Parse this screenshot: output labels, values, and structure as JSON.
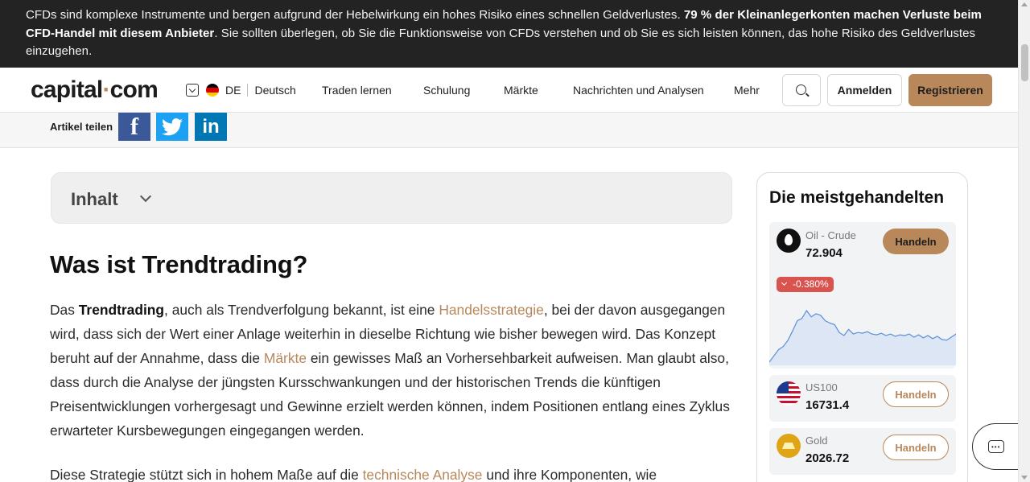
{
  "risk_banner": {
    "text_1": "CFDs sind komplexe Instrumente und bergen aufgrund der Hebelwirkung ein hohes Risiko eines schnellen Geldverlustes. ",
    "bold": "79 % der Kleinanlegerkonten machen Verluste beim CFD-Handel mit diesem Anbieter",
    "text_2": ". Sie sollten überlegen, ob Sie die Funktionsweise von CFDs verstehen und ob Sie es sich leisten können, das hohe Risiko des Geldverlustes einzugehen."
  },
  "header": {
    "logo_part1": "capital",
    "logo_dot": "·",
    "logo_part2": "com",
    "country_code": "DE",
    "language": "Deutsch",
    "nav": [
      "Traden lernen",
      "Schulung",
      "Märkte",
      "Nachrichten und Analysen",
      "Mehr"
    ],
    "login_label": "Anmelden",
    "register_label": "Registrieren"
  },
  "share": {
    "label": "Artikel teilen",
    "facebook": "f",
    "linkedin": "in"
  },
  "toc": {
    "title": "Inhalt"
  },
  "article": {
    "title": "Was ist Trendtrading?",
    "p1": {
      "t1": "Das ",
      "b1": "Trendtrading",
      "t2": ", auch als Trendverfolgung bekannt, ist eine ",
      "link1": "Handelsstrategie",
      "t3": ", bei der davon ausgegangen wird, dass sich der Wert einer Anlage weiterhin in dieselbe Richtung wie bisher bewegen wird. Das Konzept beruht auf der Annahme, dass die ",
      "link2": "Märkte",
      "t4": " ein gewisses Maß an Vorhersehbarkeit aufweisen. Man glaubt also, dass durch die Analyse der jüngsten Kursschwankungen und der historischen Trends die künftigen Preisentwicklungen vorhergesagt und Gewinne erzielt werden können, indem Positionen entlang eines Zyklus erwarteter Kursbewegungen eingegangen werden."
    },
    "p2": {
      "t1": "Diese Strategie stützt sich in hohem Maße auf die ",
      "link1": "technische Analyse",
      "t2": " und ihre Komponenten, wie"
    }
  },
  "sidebar": {
    "title": "Die meistgehandelten",
    "trade_label": "Handeln",
    "items": [
      {
        "name": "Oil - Crude",
        "price": "72.904",
        "change": "-0.380%"
      },
      {
        "name": "US100",
        "price": "16731.4"
      },
      {
        "name": "Gold",
        "price": "2026.72"
      }
    ]
  },
  "colors": {
    "accent": "#b8875a",
    "banner_bg": "#232323",
    "negative": "#d9534f",
    "sparkline": "#5b8fd6"
  },
  "sparkline": {
    "series": [
      2,
      10,
      18,
      22,
      30,
      42,
      55,
      58,
      68,
      60,
      64,
      62,
      55,
      52,
      50,
      40,
      36,
      44,
      38,
      40,
      39,
      41,
      38,
      37,
      39,
      36,
      38,
      35,
      37,
      36,
      38,
      34,
      37,
      33,
      36,
      32,
      35,
      31,
      30,
      34,
      38
    ]
  }
}
